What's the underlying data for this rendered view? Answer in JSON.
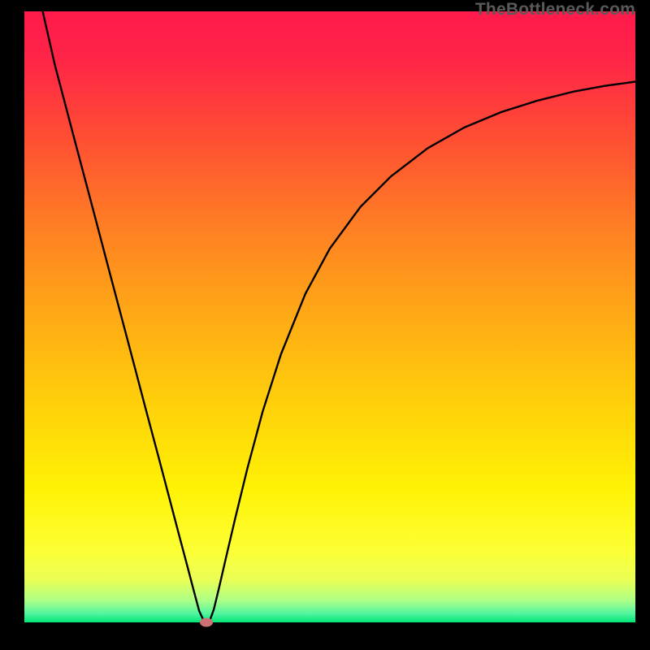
{
  "watermark": "TheBottleneck.com",
  "chart_data": {
    "type": "line",
    "title": "",
    "xlabel": "",
    "ylabel": "",
    "xlim": [
      0,
      100
    ],
    "ylim": [
      0,
      100
    ],
    "gradient_stops": [
      {
        "offset": 0.0,
        "color": "#ff1a4b"
      },
      {
        "offset": 0.08,
        "color": "#ff2547"
      },
      {
        "offset": 0.2,
        "color": "#ff4c34"
      },
      {
        "offset": 0.35,
        "color": "#ff7e24"
      },
      {
        "offset": 0.5,
        "color": "#ffaa15"
      },
      {
        "offset": 0.65,
        "color": "#ffd20a"
      },
      {
        "offset": 0.78,
        "color": "#fff205"
      },
      {
        "offset": 0.88,
        "color": "#fdff33"
      },
      {
        "offset": 0.93,
        "color": "#eaff55"
      },
      {
        "offset": 0.965,
        "color": "#aaff88"
      },
      {
        "offset": 0.985,
        "color": "#55f5a0"
      },
      {
        "offset": 1.0,
        "color": "#00e676"
      }
    ],
    "series": [
      {
        "name": "bottleneck-curve",
        "color": "#000000",
        "x": [
          3.0,
          5,
          8,
          11,
          14,
          17,
          20,
          22,
          24,
          25.5,
          26.7,
          27.8,
          28.6,
          29.2,
          29.7,
          30.0,
          30.4,
          31.0,
          31.8,
          33.0,
          34.5,
          36.5,
          39,
          42,
          46,
          50,
          55,
          60,
          66,
          72,
          78,
          84,
          90,
          95,
          100
        ],
        "y": [
          100,
          91.2,
          79.8,
          68.5,
          57.1,
          45.8,
          34.4,
          26.9,
          19.3,
          13.6,
          9.1,
          4.9,
          1.9,
          0.6,
          0.15,
          0.05,
          0.45,
          2.1,
          5.4,
          10.6,
          17.0,
          25.2,
          34.5,
          43.9,
          53.8,
          61.2,
          68.0,
          73.0,
          77.6,
          81.0,
          83.5,
          85.4,
          86.9,
          87.8,
          88.5
        ]
      }
    ],
    "marker": {
      "x": 29.8,
      "y": 0.0,
      "color": "#cf7076"
    }
  }
}
